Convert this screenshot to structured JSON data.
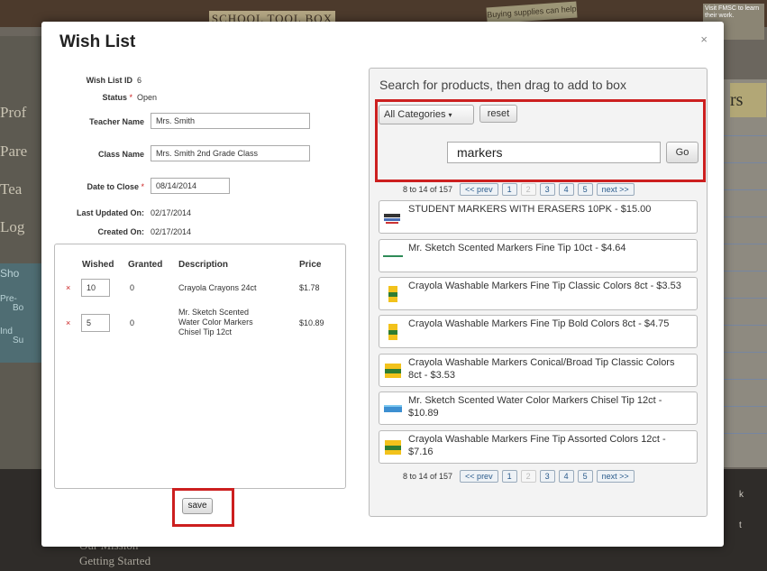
{
  "background": {
    "banner": "SCHOOL TOOL BOX",
    "note": "Buying supplies can help",
    "note_right": "Visit FMSC to learn their work.",
    "tag": "rs",
    "nav": [
      "Prof",
      "Pare",
      "Tea",
      "Log"
    ],
    "shortcut": [
      "Sho",
      "Pre-",
      "Bo",
      "Ind",
      "Su"
    ],
    "footer": [
      "Our Mission",
      "Getting Started"
    ],
    "side_text": [
      "k",
      "t"
    ]
  },
  "modal": {
    "title": "Wish List",
    "close": "×",
    "fields": {
      "wish_list_id_label": "Wish List ID",
      "wish_list_id": "6",
      "status_label": "Status",
      "status": "Open",
      "teacher_label": "Teacher Name",
      "teacher": "Mrs. Smith",
      "class_label": "Class Name",
      "class": "Mrs. Smith 2nd Grade Class",
      "date_label": "Date to Close",
      "date": "08/14/2014",
      "updated_label": "Last Updated On:",
      "updated": "02/17/2014",
      "created_label": "Created On:",
      "created": "02/17/2014",
      "required_mark": "*"
    },
    "wish_table": {
      "headers": [
        "Wished",
        "Granted",
        "Description",
        "Price"
      ],
      "rows": [
        {
          "remove": "×",
          "wished": "10",
          "granted": "0",
          "description": "Crayola Crayons 24ct",
          "price": "$1.78"
        },
        {
          "remove": "×",
          "wished": "5",
          "granted": "0",
          "description": "Mr. Sketch Scented Water Color Markers Chisel Tip 12ct",
          "price": "$10.89"
        }
      ]
    },
    "save_label": "save"
  },
  "search": {
    "heading": "Search for products, then drag to add to box",
    "category": "All Categories",
    "reset_label": "reset",
    "query": "markers",
    "go_label": "Go",
    "pager": {
      "count": "8 to 14 of 157",
      "prev": "<< prev",
      "pages": [
        "1",
        "2",
        "3",
        "4",
        "5"
      ],
      "current": "2",
      "next": "next >>"
    },
    "products": [
      {
        "name": "STUDENT MARKERS WITH ERASERS 10PK - $15.00",
        "icon": "marker-pack-icon"
      },
      {
        "name": "Mr. Sketch Scented Markers Fine Tip 10ct - $4.64",
        "icon": "marker-thin-icon"
      },
      {
        "name": "Crayola Washable Markers Fine Tip Classic Colors 8ct - $3.53",
        "icon": "crayola-box-icon"
      },
      {
        "name": "Crayola Washable Markers Fine Tip Bold Colors 8ct - $4.75",
        "icon": "crayola-box-icon"
      },
      {
        "name": "Crayola Washable Markers Conical/Broad Tip Classic Colors 8ct - $3.53",
        "icon": "crayola-box-wide-icon"
      },
      {
        "name": "Mr. Sketch Scented Water Color Markers Chisel Tip 12ct - $10.89",
        "icon": "marker-set-icon"
      },
      {
        "name": "Crayola Washable Markers Fine Tip Assorted Colors 12ct - $7.16",
        "icon": "crayola-box-wide-icon"
      }
    ]
  },
  "colors": {
    "highlight": "#cc1f1f",
    "required": "#cc2222",
    "pager_link": "#2a5b8c"
  }
}
